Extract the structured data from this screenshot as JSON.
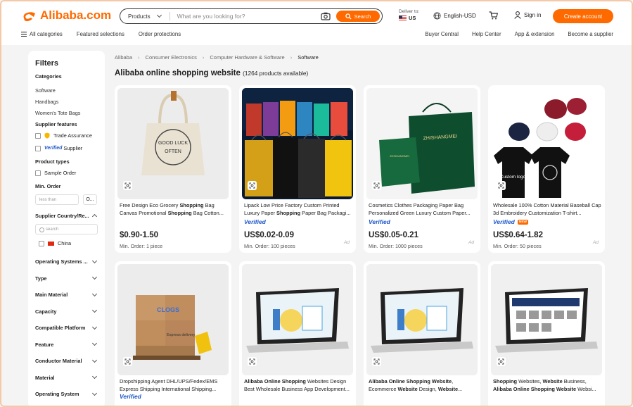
{
  "brand": {
    "name": "Alibaba.com",
    "color": "#ff6a00"
  },
  "search": {
    "category": "Products",
    "placeholder": "What are you looking for?",
    "button": "Search"
  },
  "deliver": {
    "label": "Deliver to:",
    "country": "US"
  },
  "language": "English-USD",
  "signin": "Sign in",
  "create_account": "Create account",
  "nav": {
    "all_categories": "All categories",
    "featured": "Featured selections",
    "protections": "Order protections"
  },
  "nav_right": [
    "Buyer Central",
    "Help Center",
    "App & extension",
    "Become a supplier"
  ],
  "sidebar": {
    "title": "Filters",
    "categories_head": "Categories",
    "categories": [
      "Software",
      "Handbags",
      "Women's Tote Bags"
    ],
    "supplier_features_head": "Supplier features",
    "trade_assurance": "Trade Assurance",
    "verified_label": "Verified",
    "verified_supplier": "Supplier",
    "product_types_head": "Product types",
    "sample_order": "Sample Order",
    "min_order_head": "Min. Order",
    "min_order_placeholder": "less than",
    "min_order_ok": "O...",
    "supplier_country_head": "Supplier Country/Re...",
    "country_search_placeholder": "search",
    "country": "China",
    "accordions": [
      "Operating Systems ...",
      "Type",
      "Main Material",
      "Capacity",
      "Compatible Platform",
      "Feature",
      "Conductor Material",
      "Material",
      "Operating System"
    ]
  },
  "breadcrumb": [
    "Alibaba",
    "Consumer Electronics",
    "Computer Hardware & Software",
    "Software"
  ],
  "page_title": "Alibaba online shopping website",
  "product_count": "(1264 products available)",
  "products": [
    {
      "title_html": "Free Design Eco Grocery <b>Shopping</b> Bag Canvas Promotional <b>Shopping</b> Bag Cotton...",
      "verified": false,
      "price": "$0.90-1.50",
      "min_order": "Min. Order: 1 piece",
      "ad": ""
    },
    {
      "title_html": "Lipack Low Price Factory Custom Printed Luxury Paper <b>Shopping</b> Paper Bag Packagi...",
      "verified": true,
      "price": "US$0.02-0.09",
      "min_order": "Min. Order: 100 pieces",
      "ad": "Ad"
    },
    {
      "title_html": "Cosmetics Clothes Packaging Paper Bag Personalized Green Luxury Custom Paper...",
      "verified": true,
      "price": "US$0.05-0.21",
      "min_order": "Min. Order: 1000 pieces",
      "ad": "Ad"
    },
    {
      "title_html": "Wholesale 100% Cotton Material Baseball Cap 3d Embroidery Customization T-shirt...",
      "verified": true,
      "new": "NEW",
      "price": "US$0.64-1.82",
      "min_order": "Min. Order: 50 pieces",
      "ad": "Ad"
    },
    {
      "title_html": "Dropshipping Agent DHL/UPS/Fedex/EMS Express Shipping International Shipping...",
      "verified": true,
      "price": "",
      "min_order": "",
      "ad": ""
    },
    {
      "title_html": "<b>Alibaba Online Shopping</b> Websites Design Best Wholesale Business App Development...",
      "verified": false,
      "price": "",
      "min_order": "",
      "ad": ""
    },
    {
      "title_html": "<b>Alibaba Online Shopping Website</b>, Ecommerce <b>Website</b> Design, <b>Website</b>...",
      "verified": false,
      "price": "",
      "min_order": "",
      "ad": ""
    },
    {
      "title_html": "<b>Shopping</b> Websites, <b>Website</b> Business, <b>Alibaba Online Shopping Website</b> Websi...",
      "verified": false,
      "price": "",
      "min_order": "",
      "ad": ""
    }
  ],
  "image_texts": {
    "tote_print": "GOOD LUCK OFTEN",
    "green_bag": "ZHISHANGMEI",
    "shirt_label": "Custom logo",
    "box_label": "Express delivery",
    "box_brand": "CLOGS"
  }
}
